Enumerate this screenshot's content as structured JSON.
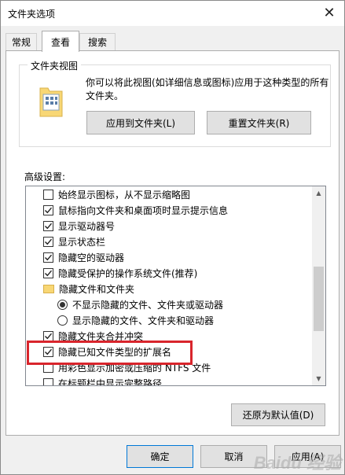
{
  "window": {
    "title": "文件夹选项",
    "close_glyph": "✕"
  },
  "tabs": [
    {
      "label": "常规"
    },
    {
      "label": "查看"
    },
    {
      "label": "搜索"
    }
  ],
  "folder_view": {
    "title": "文件夹视图",
    "description": "你可以将此视图(如详细信息或图标)应用于这种类型的所有文件夹。",
    "apply_button": "应用到文件夹(L)",
    "reset_button": "重置文件夹(R)"
  },
  "advanced": {
    "label": "高级设置:",
    "items": [
      {
        "label": "始终显示图标，从不显示缩略图",
        "type": "checkbox",
        "checked": false
      },
      {
        "label": "鼠标指向文件夹和桌面项时显示提示信息",
        "type": "checkbox",
        "checked": true
      },
      {
        "label": "显示驱动器号",
        "type": "checkbox",
        "checked": true
      },
      {
        "label": "显示状态栏",
        "type": "checkbox",
        "checked": true
      },
      {
        "label": "隐藏空的驱动器",
        "type": "checkbox",
        "checked": true
      },
      {
        "label": "隐藏受保护的操作系统文件(推荐)",
        "type": "checkbox",
        "checked": true
      },
      {
        "label": "隐藏文件和文件夹",
        "type": "folder"
      },
      {
        "label": "不显示隐藏的文件、文件夹或驱动器",
        "type": "radio",
        "checked": true
      },
      {
        "label": "显示隐藏的文件、文件夹和驱动器",
        "type": "radio",
        "checked": false
      },
      {
        "label": "隐藏文件夹合并冲突",
        "type": "checkbox",
        "checked": true
      },
      {
        "label": "隐藏已知文件类型的扩展名",
        "type": "checkbox",
        "checked": true
      },
      {
        "label": "用彩色显示加密或压缩的 NTFS 文件",
        "type": "checkbox",
        "checked": false
      },
      {
        "label": "在标题栏中显示完整路径",
        "type": "checkbox",
        "checked": false
      }
    ],
    "restore_button": "还原为默认值(D)"
  },
  "footer": {
    "ok": "确定",
    "cancel": "取消",
    "apply": "应用(A)"
  },
  "watermark": "Baidu 经验",
  "colors": {
    "highlight": "#d9252c",
    "accent": "#0078d7",
    "folder": "#f8d775"
  }
}
